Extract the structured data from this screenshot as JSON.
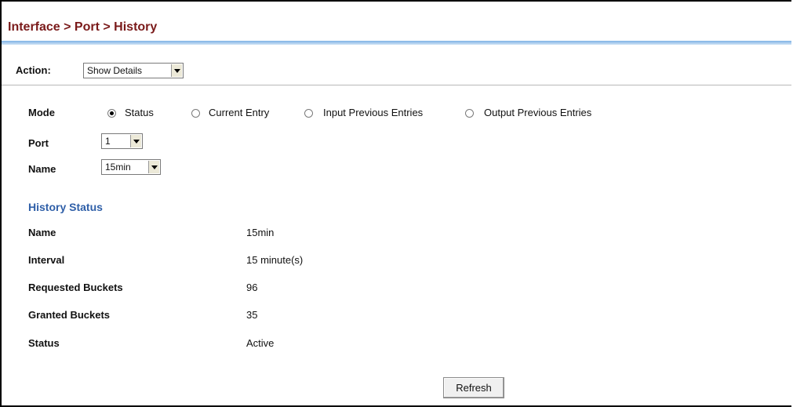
{
  "header": {
    "breadcrumb": "Interface > Port > History"
  },
  "action": {
    "label": "Action:",
    "selected": "Show Details"
  },
  "mode": {
    "label": "Mode",
    "options": [
      "Status",
      "Current Entry",
      "Input Previous Entries",
      "Output Previous Entries"
    ],
    "selected_index": 0
  },
  "port": {
    "label": "Port",
    "selected": "1"
  },
  "name": {
    "label": "Name",
    "selected": "15min"
  },
  "history_status": {
    "title": "History Status",
    "rows": [
      {
        "label": "Name",
        "value": "15min"
      },
      {
        "label": "Interval",
        "value": "15 minute(s)"
      },
      {
        "label": "Requested Buckets",
        "value": "96"
      },
      {
        "label": "Granted Buckets",
        "value": "35"
      },
      {
        "label": "Status",
        "value": "Active"
      }
    ]
  },
  "buttons": {
    "refresh": "Refresh"
  },
  "colors": {
    "title": "#7a1a1a",
    "section": "#2f5fa8",
    "rule": "#7fb2e6"
  }
}
